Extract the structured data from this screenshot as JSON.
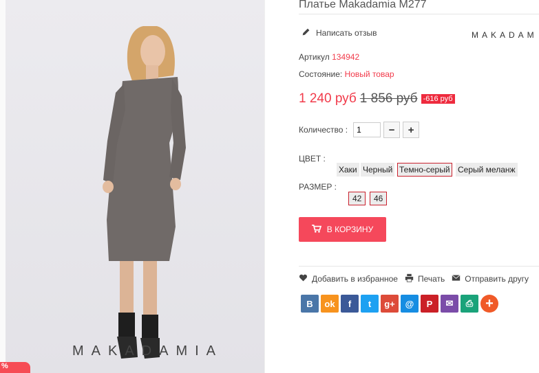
{
  "product": {
    "title": "Платье Makadamia M277",
    "review_label": "Написать отзыв",
    "brand_logo": "MAKADAM",
    "article_label": "Артикул",
    "article_value": "134942",
    "condition_label": "Состояние:",
    "condition_value": "Новый товар",
    "price_current": "1 240 руб",
    "price_old": "1 856 руб",
    "discount": "-616 руб",
    "quantity_label": "Количество :",
    "quantity_value": "1",
    "color_label": "ЦВЕТ :",
    "colors": [
      "Хаки",
      "Черный",
      "Темно-серый",
      "Серый меланж"
    ],
    "size_label": "РАЗМЕР :",
    "sizes": [
      "42",
      "46"
    ],
    "cart_label": "В КОРЗИНУ"
  },
  "photo": {
    "watermark": "MAKADAMIA",
    "badge": "%"
  },
  "actions": {
    "favorite": "Добавить в избранное",
    "print": "Печать",
    "send": "Отправить другу"
  },
  "social": {
    "icons": [
      "vk-icon",
      "odnoklassniki-icon",
      "facebook-icon",
      "twitter-icon",
      "google-plus-icon",
      "mail-ru-icon",
      "pinterest-icon",
      "email-icon",
      "print-icon",
      "more-icon"
    ],
    "colors": [
      "#4a76a8",
      "#f7931e",
      "#3b5998",
      "#1da1f2",
      "#dd4b39",
      "#168de2",
      "#cb2027",
      "#7b4ca8",
      "#1aa37a",
      "#f05a28"
    ]
  }
}
